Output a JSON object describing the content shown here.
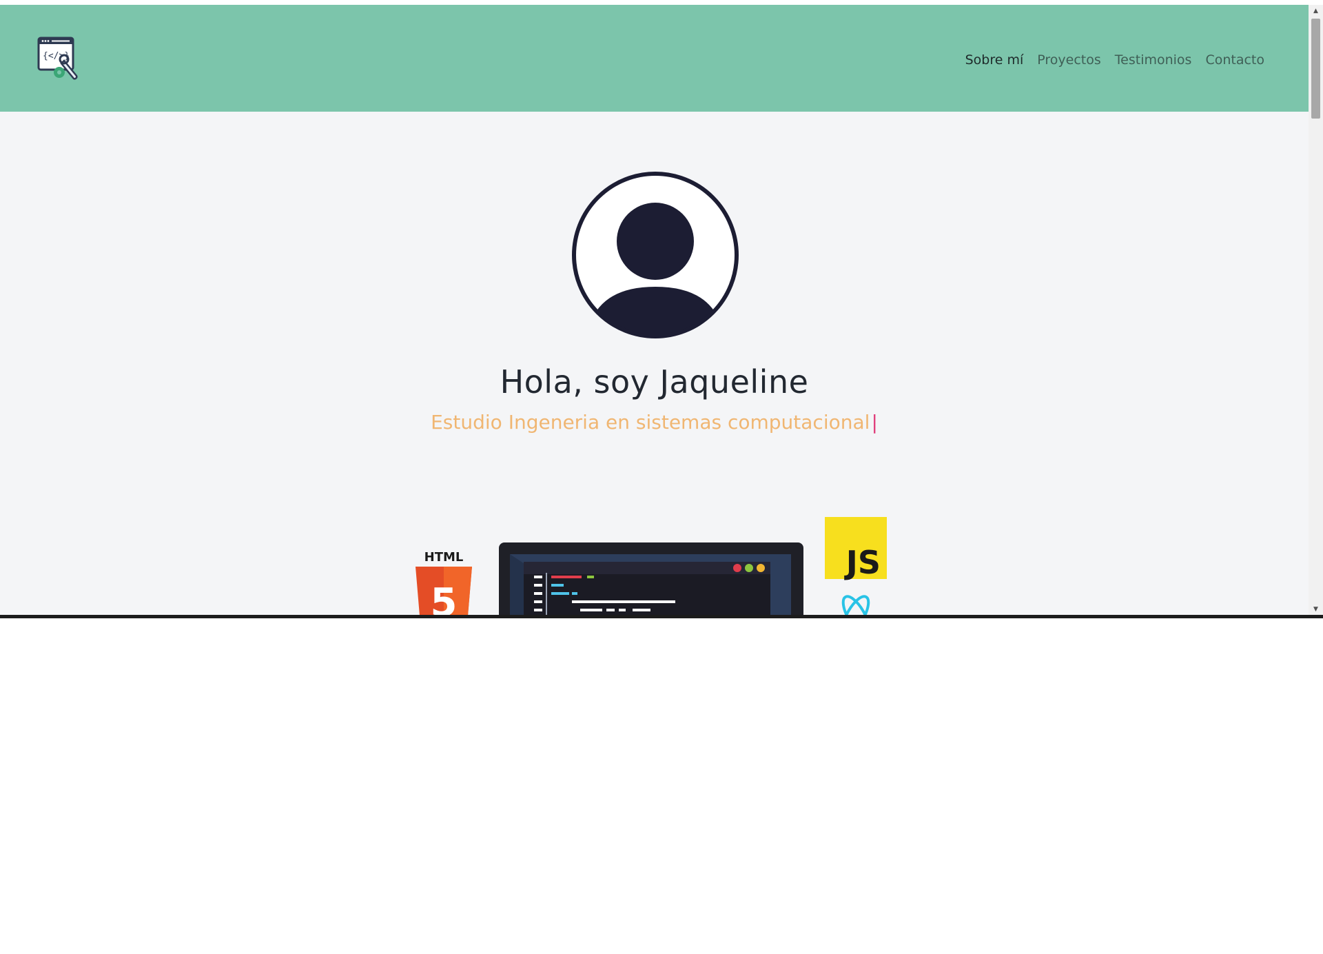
{
  "nav": {
    "links": [
      {
        "label": "Sobre mí",
        "active": true
      },
      {
        "label": "Proyectos",
        "active": false
      },
      {
        "label": "Testimonios",
        "active": false
      },
      {
        "label": "Contacto",
        "active": false
      }
    ]
  },
  "hero": {
    "name": "Hola, soy Jaqueline",
    "subtitle": "Estudio Ingeneria en sistemas computacional",
    "cursor": "|"
  },
  "illustration": {
    "html_badge": "HTML",
    "html_digit": "5",
    "js_badge": "JS"
  },
  "colors": {
    "navbar": "#7cc5ab",
    "background": "#f4f5f7",
    "subtitle": "#f0b672",
    "cursor": "#e03d7a",
    "avatar": "#1c1d33",
    "js_yellow": "#f7df1e",
    "html_orange": "#e44d26"
  },
  "icons": {
    "logo": "code-window-wrench-icon",
    "avatar": "user-avatar-icon",
    "scroll_up": "chevron-up-icon",
    "scroll_down": "chevron-down-icon"
  }
}
